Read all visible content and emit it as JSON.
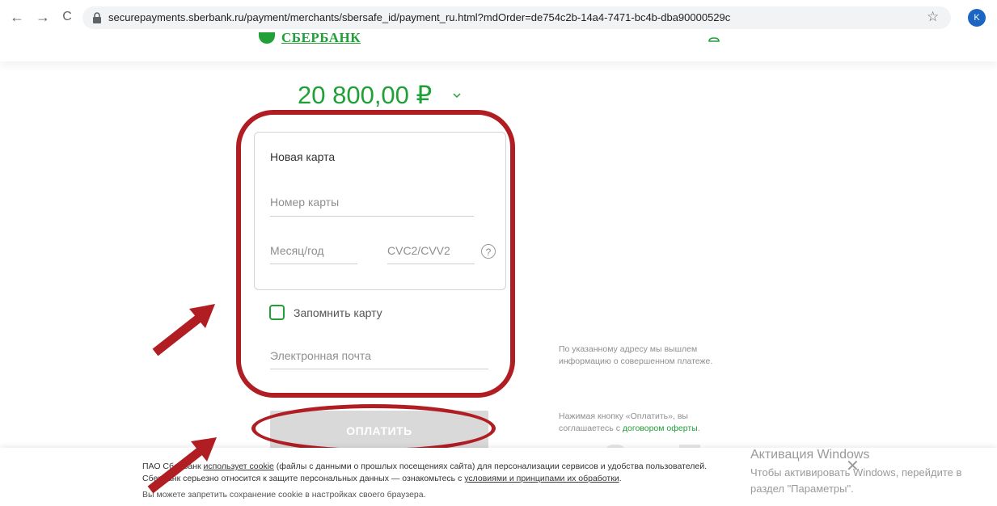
{
  "browser": {
    "back_icon": "←",
    "forward_icon": "→",
    "reload_icon": "C",
    "url": "securepayments.sberbank.ru/payment/merchants/sbersafe_id/payment_ru.html?mdOrder=de754c2b-14a4-7471-bc4b-dba90000529c",
    "star_icon": "☆",
    "avatar_letter": "K"
  },
  "header": {
    "logo_text": "СБЕРБАНК"
  },
  "payment": {
    "amount": "20 800,00 ₽",
    "card_title": "Новая карта",
    "card_number_placeholder": "Номер карты",
    "expiry_placeholder": "Месяц/год",
    "cvc_placeholder": "CVC2/CVV2",
    "help_icon": "?",
    "remember_label": "Запомнить карту",
    "email_placeholder": "Электронная почта",
    "pay_label": "ОПЛАТИТЬ"
  },
  "notes": {
    "email_note": "По указанному адресу мы вышлем информацию о совершенном платеже.",
    "offer_prefix": "Нажимая кнопку «Оплатить», вы соглашаетесь с ",
    "offer_link": "договором оферты",
    "offer_suffix": "."
  },
  "cookie": {
    "line1_a": "ПАО Сбербанк ",
    "line1_link": "использует cookie",
    "line1_b": " (файлы с данными о прошлых посещениях сайта) для персонализации сервисов и удобства пользователей.",
    "line2_a": "Сбербанк серьезно относится к защите персональных данных — ознакомьтесь с ",
    "line2_link": "условиями и принципами их обработки",
    "line2_b": ".",
    "line3": "Вы можете запретить сохранение cookie в настройках своего браузера.",
    "close_icon": "✕"
  },
  "windows": {
    "title": "Активация Windows",
    "line1": "Чтобы активировать Windows, перейдите в",
    "line2": "раздел \"Параметры\"."
  },
  "colors": {
    "brand_green": "#21a038",
    "annotation_red": "#b01e24",
    "button_disabled": "#d9d9d9"
  }
}
